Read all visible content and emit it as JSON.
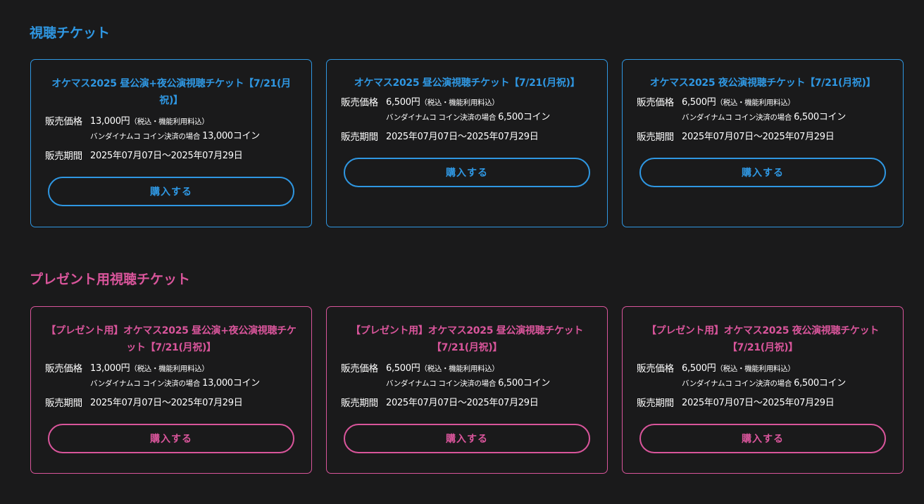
{
  "sections": [
    {
      "title": "視聴チケット",
      "cards": [
        {
          "title": "オケマス2025 昼公演+夜公演視聴チケット【7/21(月祝)】",
          "price_label": "販売価格",
          "price": "13,000円",
          "price_note": "（税込・機能利用料込）",
          "coin_prefix": "バンダイナムコ コイン決済の場合",
          "coin_value": "13,000コイン",
          "period_label": "販売期間",
          "period": "2025年07月07日〜2025年07月29日",
          "button": "購入する"
        },
        {
          "title": "オケマス2025 昼公演視聴チケット【7/21(月祝)】",
          "price_label": "販売価格",
          "price": "6,500円",
          "price_note": "（税込・機能利用料込）",
          "coin_prefix": "バンダイナムコ コイン決済の場合",
          "coin_value": "6,500コイン",
          "period_label": "販売期間",
          "period": "2025年07月07日〜2025年07月29日",
          "button": "購入する"
        },
        {
          "title": "オケマス2025 夜公演視聴チケット【7/21(月祝)】",
          "price_label": "販売価格",
          "price": "6,500円",
          "price_note": "（税込・機能利用料込）",
          "coin_prefix": "バンダイナムコ コイン決済の場合",
          "coin_value": "6,500コイン",
          "period_label": "販売期間",
          "period": "2025年07月07日〜2025年07月29日",
          "button": "購入する"
        }
      ]
    },
    {
      "title": "プレゼント用視聴チケット",
      "cards": [
        {
          "title": "【プレゼント用】オケマス2025 昼公演+夜公演視聴チケット【7/21(月祝)】",
          "price_label": "販売価格",
          "price": "13,000円",
          "price_note": "（税込・機能利用料込）",
          "coin_prefix": "バンダイナムコ コイン決済の場合",
          "coin_value": "13,000コイン",
          "period_label": "販売期間",
          "period": "2025年07月07日〜2025年07月29日",
          "button": "購入する"
        },
        {
          "title": "【プレゼント用】オケマス2025 昼公演視聴チケット【7/21(月祝)】",
          "price_label": "販売価格",
          "price": "6,500円",
          "price_note": "（税込・機能利用料込）",
          "coin_prefix": "バンダイナムコ コイン決済の場合",
          "coin_value": "6,500コイン",
          "period_label": "販売期間",
          "period": "2025年07月07日〜2025年07月29日",
          "button": "購入する"
        },
        {
          "title": "【プレゼント用】オケマス2025 夜公演視聴チケット【7/21(月祝)】",
          "price_label": "販売価格",
          "price": "6,500円",
          "price_note": "（税込・機能利用料込）",
          "coin_prefix": "バンダイナムコ コイン決済の場合",
          "coin_value": "6,500コイン",
          "period_label": "販売期間",
          "period": "2025年07月07日〜2025年07月29日",
          "button": "購入する"
        }
      ]
    }
  ],
  "colors": {
    "background": "#1a1a1b",
    "accent_blue": "#2f97e2",
    "accent_pink": "#d9559b",
    "text": "#ffffff"
  }
}
